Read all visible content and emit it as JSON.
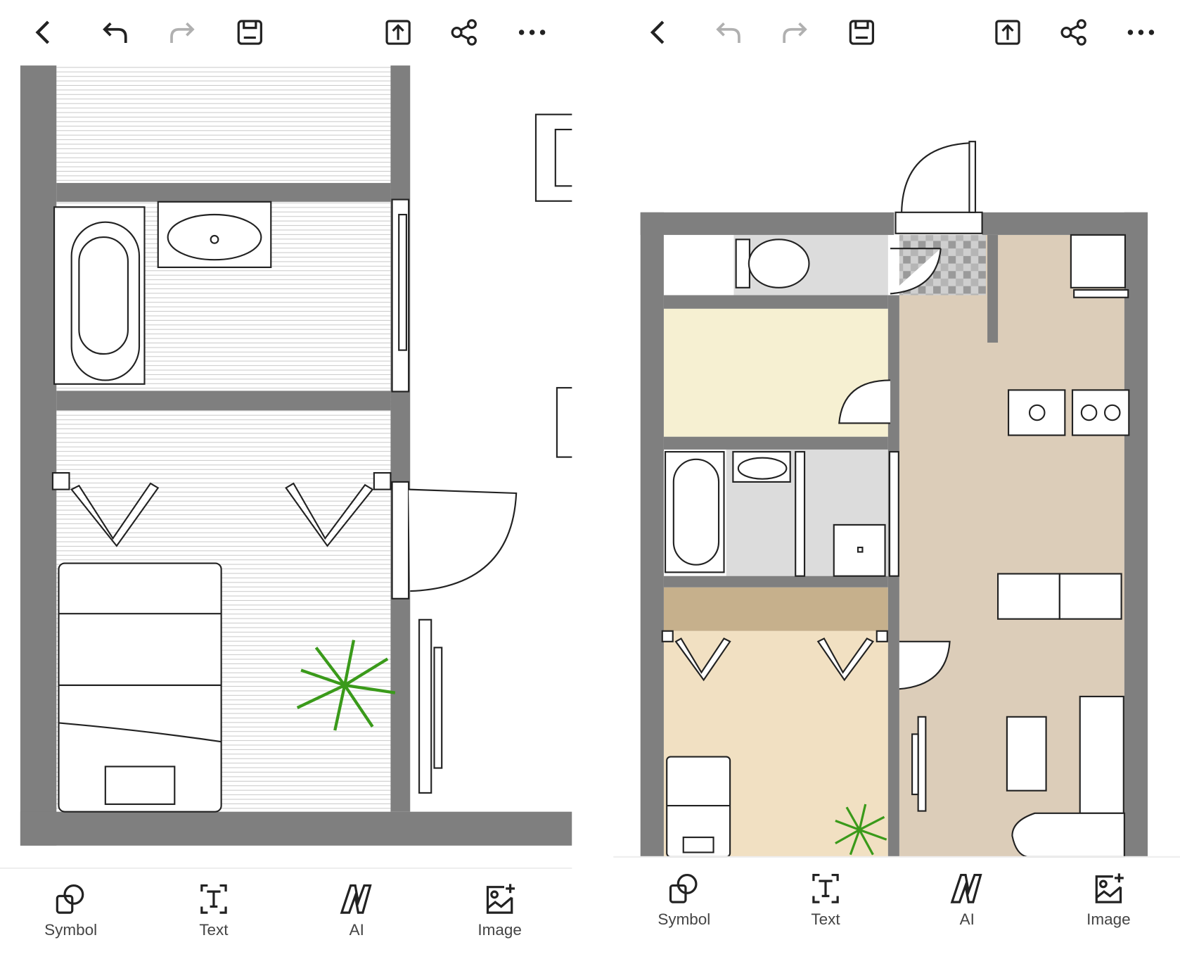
{
  "left_screen": {
    "toolbar": [
      {
        "name": "back",
        "icon": "chevron-left-icon",
        "enabled": true
      },
      {
        "name": "undo",
        "icon": "undo-icon",
        "enabled": true
      },
      {
        "name": "redo",
        "icon": "redo-icon",
        "enabled": false
      },
      {
        "name": "save",
        "icon": "save-icon",
        "enabled": true
      },
      {
        "name": "export",
        "icon": "export-icon",
        "enabled": true
      },
      {
        "name": "share",
        "icon": "share-icon",
        "enabled": true
      },
      {
        "name": "more",
        "icon": "more-icon",
        "enabled": true
      }
    ],
    "bottom_tools": [
      {
        "label": "Symbol",
        "icon": "shapes-icon"
      },
      {
        "label": "Text",
        "icon": "text-box-icon"
      },
      {
        "label": "AI",
        "icon": "ai-icon"
      },
      {
        "label": "Image",
        "icon": "add-image-icon"
      }
    ]
  },
  "right_screen": {
    "toolbar": [
      {
        "name": "back",
        "icon": "chevron-left-icon",
        "enabled": true
      },
      {
        "name": "undo",
        "icon": "undo-icon",
        "enabled": false
      },
      {
        "name": "redo",
        "icon": "redo-icon",
        "enabled": false
      },
      {
        "name": "save",
        "icon": "save-icon",
        "enabled": true
      },
      {
        "name": "export",
        "icon": "export-icon",
        "enabled": true
      },
      {
        "name": "share",
        "icon": "share-icon",
        "enabled": true
      },
      {
        "name": "more",
        "icon": "more-icon",
        "enabled": true
      }
    ],
    "bottom_tools": [
      {
        "label": "Symbol",
        "icon": "shapes-icon"
      },
      {
        "label": "Text",
        "icon": "text-box-icon"
      },
      {
        "label": "AI",
        "icon": "ai-icon"
      },
      {
        "label": "Image",
        "icon": "add-image-icon"
      }
    ]
  },
  "colors": {
    "wall": "#808080",
    "icon_active": "#222222",
    "icon_disabled": "#b0b0b0",
    "label": "#444444"
  }
}
